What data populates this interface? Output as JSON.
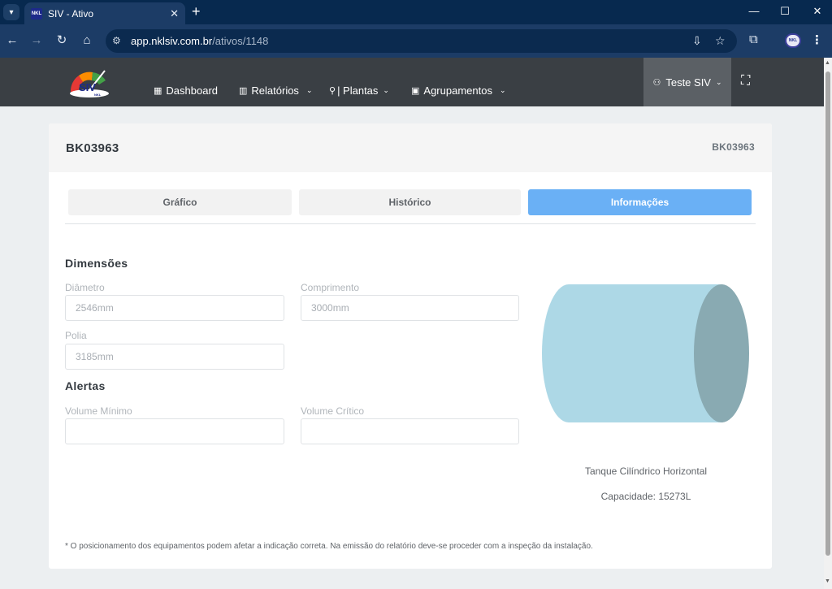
{
  "browser": {
    "tab_title": "SIV - Ativo",
    "favicon_text": "NKL",
    "url_host": "app.nklsiv.com.br",
    "url_path": "/ativos/1148",
    "profile_text": "NKL"
  },
  "header": {
    "logo_text": "SIV",
    "logo_sub": "NKL",
    "nav": [
      {
        "label": "Dashboard",
        "icon": "dashboard-icon"
      },
      {
        "label": "Relatórios",
        "icon": "bar-chart-icon"
      },
      {
        "label": "| Plantas",
        "icon": "drop-icon"
      },
      {
        "label": "Agrupamentos",
        "icon": "group-icon"
      }
    ],
    "user_label": "Teste SIV"
  },
  "card": {
    "title": "BK03963",
    "code": "BK03963",
    "tabs": [
      {
        "label": "Gráfico",
        "active": false
      },
      {
        "label": "Histórico",
        "active": false
      },
      {
        "label": "Informações",
        "active": true
      }
    ],
    "dimensions": {
      "title": "Dimensões",
      "diametro_label": "Diâmetro",
      "diametro_value": "2546mm",
      "comprimento_label": "Comprimento",
      "comprimento_value": "3000mm",
      "polia_label": "Polia",
      "polia_value": "3185mm"
    },
    "alerts": {
      "title": "Alertas",
      "volume_minimo_label": "Volume Mínimo",
      "volume_minimo_value": "",
      "volume_critico_label": "Volume Crítico",
      "volume_critico_value": ""
    },
    "tank": {
      "type_label": "Tanque Cilíndrico Horizontal",
      "capacity_label": "Capacidade: 15273L",
      "body_color": "#add8e6",
      "end_color": "#89aab2"
    },
    "footnote": "* O posicionamento dos equipamentos podem afetar a indicação correta. Na emissão do relatório deve-se proceder com a inspeção da instalação."
  },
  "colors": {
    "active_tab": "#6ab0f5",
    "header_bg": "#3a3f44",
    "browser_bg": "#1c3c66"
  }
}
